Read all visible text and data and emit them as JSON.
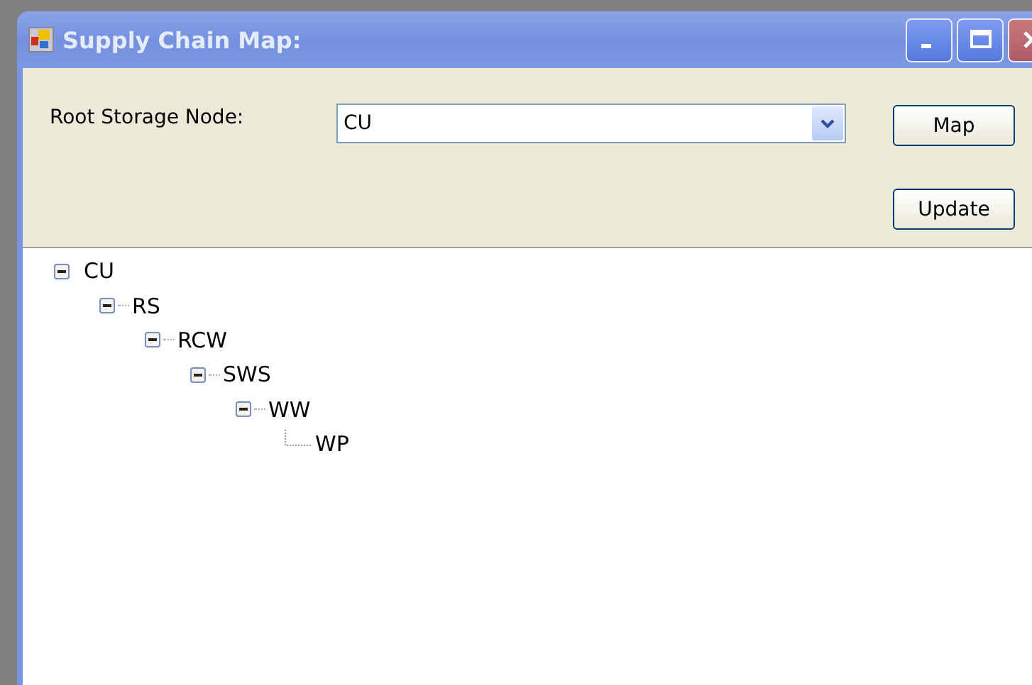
{
  "window": {
    "title": "Supply Chain Map:"
  },
  "form": {
    "root_label": "Root Storage Node:",
    "root_combo": {
      "value": "CU"
    },
    "buttons": [
      "Map",
      "Update"
    ]
  },
  "tree": [
    {
      "label": "CU",
      "expanded": true,
      "children": [
        {
          "label": "RS",
          "expanded": true,
          "children": [
            {
              "label": "RCW",
              "expanded": true,
              "children": [
                {
                  "label": "SWS",
                  "expanded": true,
                  "children": [
                    {
                      "label": "WW",
                      "expanded": true,
                      "children": [
                        {
                          "label": "WP"
                        }
                      ]
                    }
                  ]
                }
              ]
            }
          ]
        }
      ]
    }
  ]
}
